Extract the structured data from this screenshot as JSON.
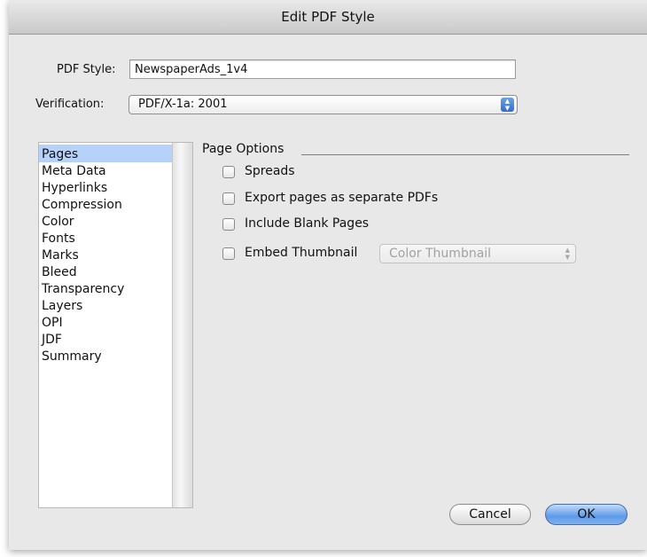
{
  "window": {
    "title": "Edit PDF Style"
  },
  "pdf_style": {
    "label": "PDF Style:",
    "value": "NewspaperAds_1v4"
  },
  "verification": {
    "label": "Verification:",
    "value": "PDF/X-1a: 2001"
  },
  "sidebar": {
    "items": [
      {
        "label": "Pages",
        "selected": true
      },
      {
        "label": "Meta Data"
      },
      {
        "label": "Hyperlinks"
      },
      {
        "label": "Compression"
      },
      {
        "label": "Color"
      },
      {
        "label": "Fonts"
      },
      {
        "label": "Marks"
      },
      {
        "label": "Bleed"
      },
      {
        "label": "Transparency"
      },
      {
        "label": "Layers"
      },
      {
        "label": "OPI"
      },
      {
        "label": "JDF"
      },
      {
        "label": "Summary"
      }
    ]
  },
  "page_options": {
    "title": "Page Options",
    "options": [
      {
        "label": "Spreads",
        "checked": false
      },
      {
        "label": "Export pages as separate PDFs",
        "checked": false
      },
      {
        "label": "Include Blank Pages",
        "checked": false
      },
      {
        "label": "Embed Thumbnail",
        "checked": false
      }
    ],
    "thumbnail_select": {
      "value": "Color Thumbnail",
      "enabled": false
    }
  },
  "buttons": {
    "cancel": "Cancel",
    "ok": "OK"
  }
}
